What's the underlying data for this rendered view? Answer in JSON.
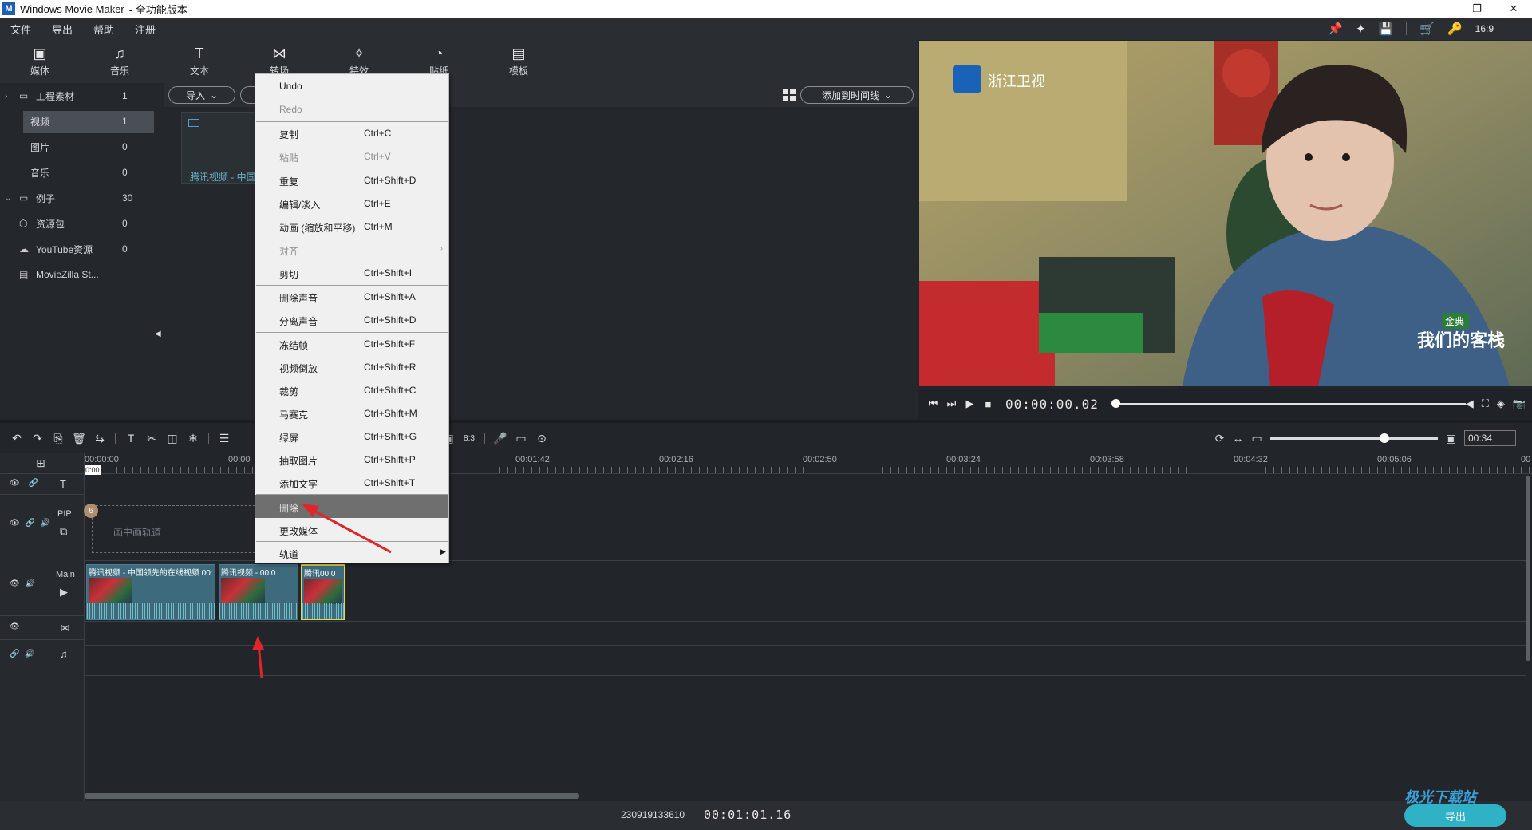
{
  "window": {
    "title": "Windows Movie Maker",
    "subtitle": "- 全功能版本",
    "logo_letter": "M",
    "controls": {
      "minimize": "—",
      "maximize": "❐",
      "close": "✕"
    }
  },
  "menubar": {
    "items": [
      "文件",
      "导出",
      "帮助",
      "注册"
    ],
    "right_icons": {
      "pin": "📌",
      "badge": "✦",
      "save": "💾",
      "cart": "🛒",
      "key": "🔑",
      "ratio": "16:9"
    }
  },
  "tool_tabs": [
    {
      "label": "媒体",
      "icon": "▣"
    },
    {
      "label": "音乐",
      "icon": "♫"
    },
    {
      "label": "文本",
      "icon": "T"
    },
    {
      "label": "转场",
      "icon": "⋈"
    },
    {
      "label": "特效",
      "icon": "✧"
    },
    {
      "label": "贴纸",
      "icon": "◔"
    },
    {
      "label": "模板",
      "icon": "▤"
    }
  ],
  "library": {
    "rows": [
      {
        "label": "工程素材",
        "count": "1",
        "chevron": "›",
        "icon": "▭"
      },
      {
        "label": "视频",
        "count": "1"
      },
      {
        "label": "图片",
        "count": "0"
      },
      {
        "label": "音乐",
        "count": "0"
      },
      {
        "label": "例子",
        "count": "30",
        "chevron": "⌄",
        "icon": "▭"
      },
      {
        "label": "资源包",
        "count": "0",
        "icon": "⬡"
      },
      {
        "label": "YouTube资源",
        "count": "0",
        "icon": "☁"
      },
      {
        "label": "MovieZilla St...",
        "count": "",
        "icon": "▤"
      }
    ],
    "collapse_arrow": "◀"
  },
  "media_bin": {
    "import_label": "导入",
    "add_to_timeline_label": "添加到时间线",
    "dropdown": "⌄",
    "clip_caption": "腾讯视频 - 中国领先的在线视频"
  },
  "player": {
    "prev": "⏮",
    "step": "⏭",
    "play": "▶",
    "stop": "■",
    "timecode": "00:00:00.02",
    "progress": 0.0,
    "volume": "◀",
    "fullscreen": "⛶",
    "snapshot": "📷",
    "bucket": "◈"
  },
  "video_overlay": {
    "channel": "浙江卫视",
    "show_logo": "我们的客栈",
    "show_badge": "金典"
  },
  "timeline_toolbar": {
    "left_icons": [
      "↶",
      "↷",
      "⎘",
      "🗑",
      "⇆",
      "T",
      "✂",
      "◫",
      "❄",
      "☰"
    ],
    "mid_icons": [
      "▣",
      "8:3",
      "🎤",
      "▭",
      "⊙"
    ],
    "right_icons": {
      "sync": "⟳",
      "fit": "↔",
      "zoom_out": "▭",
      "zoom_in": "▣"
    },
    "zoom_level": 0.68,
    "duration": "00:34"
  },
  "ruler": {
    "ticks": [
      "00:00:00",
      "00:00",
      "00:01:42",
      "00:02:16",
      "00:02:50",
      "00:03:24",
      "00:03:58",
      "00:04:32",
      "00:05:06",
      "00"
    ],
    "playhead": "0:00"
  },
  "tracks": {
    "text": {
      "icon": "T",
      "controls": "👁 🔗"
    },
    "pip": {
      "label": "PIP",
      "placeholder": "画中画轨道",
      "controls": "👁 🔗 🔊",
      "badge": "6"
    },
    "main": {
      "label": "Main",
      "controls": "👁 🔊"
    },
    "transition": {
      "controls": "👁",
      "icon": "⋈"
    },
    "audio": {
      "controls": "🔗 🔊",
      "icon": "♫"
    },
    "main_clips": [
      {
        "title": "腾讯视频 - 中国领先的在线视频 00:0"
      },
      {
        "title": "腾讯视频 - 00:0"
      },
      {
        "title": "腾讯00:0"
      }
    ]
  },
  "context_menu": {
    "items": [
      {
        "label": "Undo",
        "shortcut": ""
      },
      {
        "label": "Redo",
        "shortcut": ""
      },
      {
        "label": "复制",
        "shortcut": "Ctrl+C"
      },
      {
        "label": "粘贴",
        "shortcut": "Ctrl+V"
      },
      {
        "label": "重复",
        "shortcut": "Ctrl+Shift+D"
      },
      {
        "label": "编辑/淡入",
        "shortcut": "Ctrl+E"
      },
      {
        "label": "动画 (缩放和平移)",
        "shortcut": "Ctrl+M"
      },
      {
        "label": "对齐",
        "shortcut": ""
      },
      {
        "label": "剪切",
        "shortcut": "Ctrl+Shift+I"
      },
      {
        "label": "删除声音",
        "shortcut": "Ctrl+Shift+A"
      },
      {
        "label": "分离声音",
        "shortcut": "Ctrl+Shift+D"
      },
      {
        "label": "冻结帧",
        "shortcut": "Ctrl+Shift+F"
      },
      {
        "label": "视频倒放",
        "shortcut": "Ctrl+Shift+R"
      },
      {
        "label": "裁剪",
        "shortcut": "Ctrl+Shift+C"
      },
      {
        "label": "马赛克",
        "shortcut": "Ctrl+Shift+M"
      },
      {
        "label": "绿屏",
        "shortcut": "Ctrl+Shift+G"
      },
      {
        "label": "抽取图片",
        "shortcut": "Ctrl+Shift+P"
      },
      {
        "label": "添加文字",
        "shortcut": "Ctrl+Shift+T"
      },
      {
        "label": "删除",
        "shortcut": ""
      },
      {
        "label": "更改媒体",
        "shortcut": ""
      },
      {
        "label": "轨道",
        "shortcut": ""
      }
    ],
    "submenu_arrow": "›",
    "submenu_arrow_solid": "▶"
  },
  "statusbar": {
    "project_id": "230919133610",
    "timecode": "00:01:01.16",
    "export_label": "导出"
  },
  "watermark": "极光下载站"
}
